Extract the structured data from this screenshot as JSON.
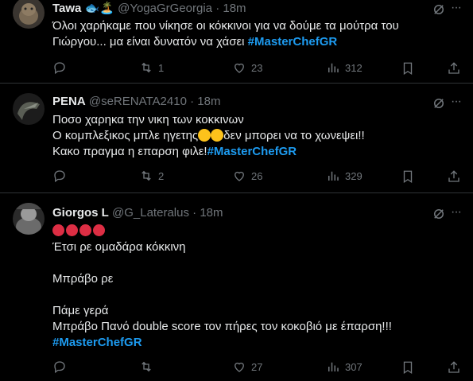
{
  "tweets": [
    {
      "name": "Tawa",
      "name_emoji": "🐟🏝️",
      "handle": "@YogaGrGeorgia",
      "dot": "·",
      "time": "18m",
      "text_line1": "Όλοι χαρήκαμε που νίκησε οι κόκκινοι για να δούμε τα μούτρα του",
      "text_line2_prefix": "Γιώργου... μα είναι δυνατόν να χάσει ",
      "hashtag": "#MasterChefGR",
      "replies": "",
      "reposts": "1",
      "likes": "23",
      "views": "312"
    },
    {
      "name": "PENA",
      "handle": "@seRENATA2410",
      "dot": "·",
      "time": "18m",
      "line1": "Ποσο χαρηκα την νικη των κοκκινων",
      "line2_prefix": "Ο κομπλεξικος μπλε ηγετης",
      "line2_suffix": "δεν μπορει να το χωνεψει!!",
      "line3_prefix": "Κακο πραγμα η επαρση φιλε!",
      "hashtag": "#MasterChefGR",
      "replies": "",
      "reposts": "2",
      "likes": "26",
      "views": "329"
    },
    {
      "name": "Giorgos L",
      "handle": "@G_Lateralus",
      "dot": "·",
      "time": "18m",
      "line1": "Έτσι ρε ομαδάρα κόκκινη",
      "line2": "Μπράβο ρε",
      "line3": "Πάμε γερά",
      "line4": "Μπράβο Πανό double score τον πήρες τον κοκοβιό με έπαρση!!!",
      "hashtag": "#MasterChefGR",
      "replies": "",
      "reposts": "",
      "likes": "27",
      "views": "307"
    }
  ],
  "icons": {
    "reply": "reply-icon",
    "repost": "repost-icon",
    "like": "heart-icon",
    "views": "views-icon",
    "bookmark": "bookmark-icon",
    "share": "share-icon",
    "grok": "grok-icon",
    "more": "more-icon"
  },
  "colors": {
    "background": "#000000",
    "text": "#e7e9ea",
    "muted": "#71767b",
    "hashtag": "#1d9bf0",
    "divider": "#2f3336"
  }
}
